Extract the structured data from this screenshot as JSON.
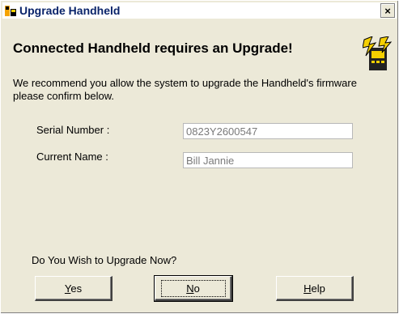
{
  "window": {
    "title": "Upgrade Handheld",
    "close_label": "×"
  },
  "main": {
    "headline": "Connected Handheld requires an Upgrade!",
    "message": "We recommend you allow the system to upgrade the Handheld's firmware please confirm below.",
    "fields": {
      "serial_label": "Serial Number :",
      "serial_value": "0823Y2600547",
      "name_label": "Current Name :",
      "name_value": "Bill Jannie"
    },
    "question": "Do You Wish to Upgrade Now?"
  },
  "buttons": {
    "yes_accel": "Y",
    "yes_rest": "es",
    "no_accel": "N",
    "no_rest": "o",
    "help_accel": "H",
    "help_rest": "elp"
  },
  "icons": {
    "app": "handheld-app-icon",
    "warning": "lightning-handheld-icon"
  },
  "colors": {
    "dialog_bg": "#ece9d8",
    "title_text": "#0a246a",
    "icon_yellow": "#f5d000"
  }
}
